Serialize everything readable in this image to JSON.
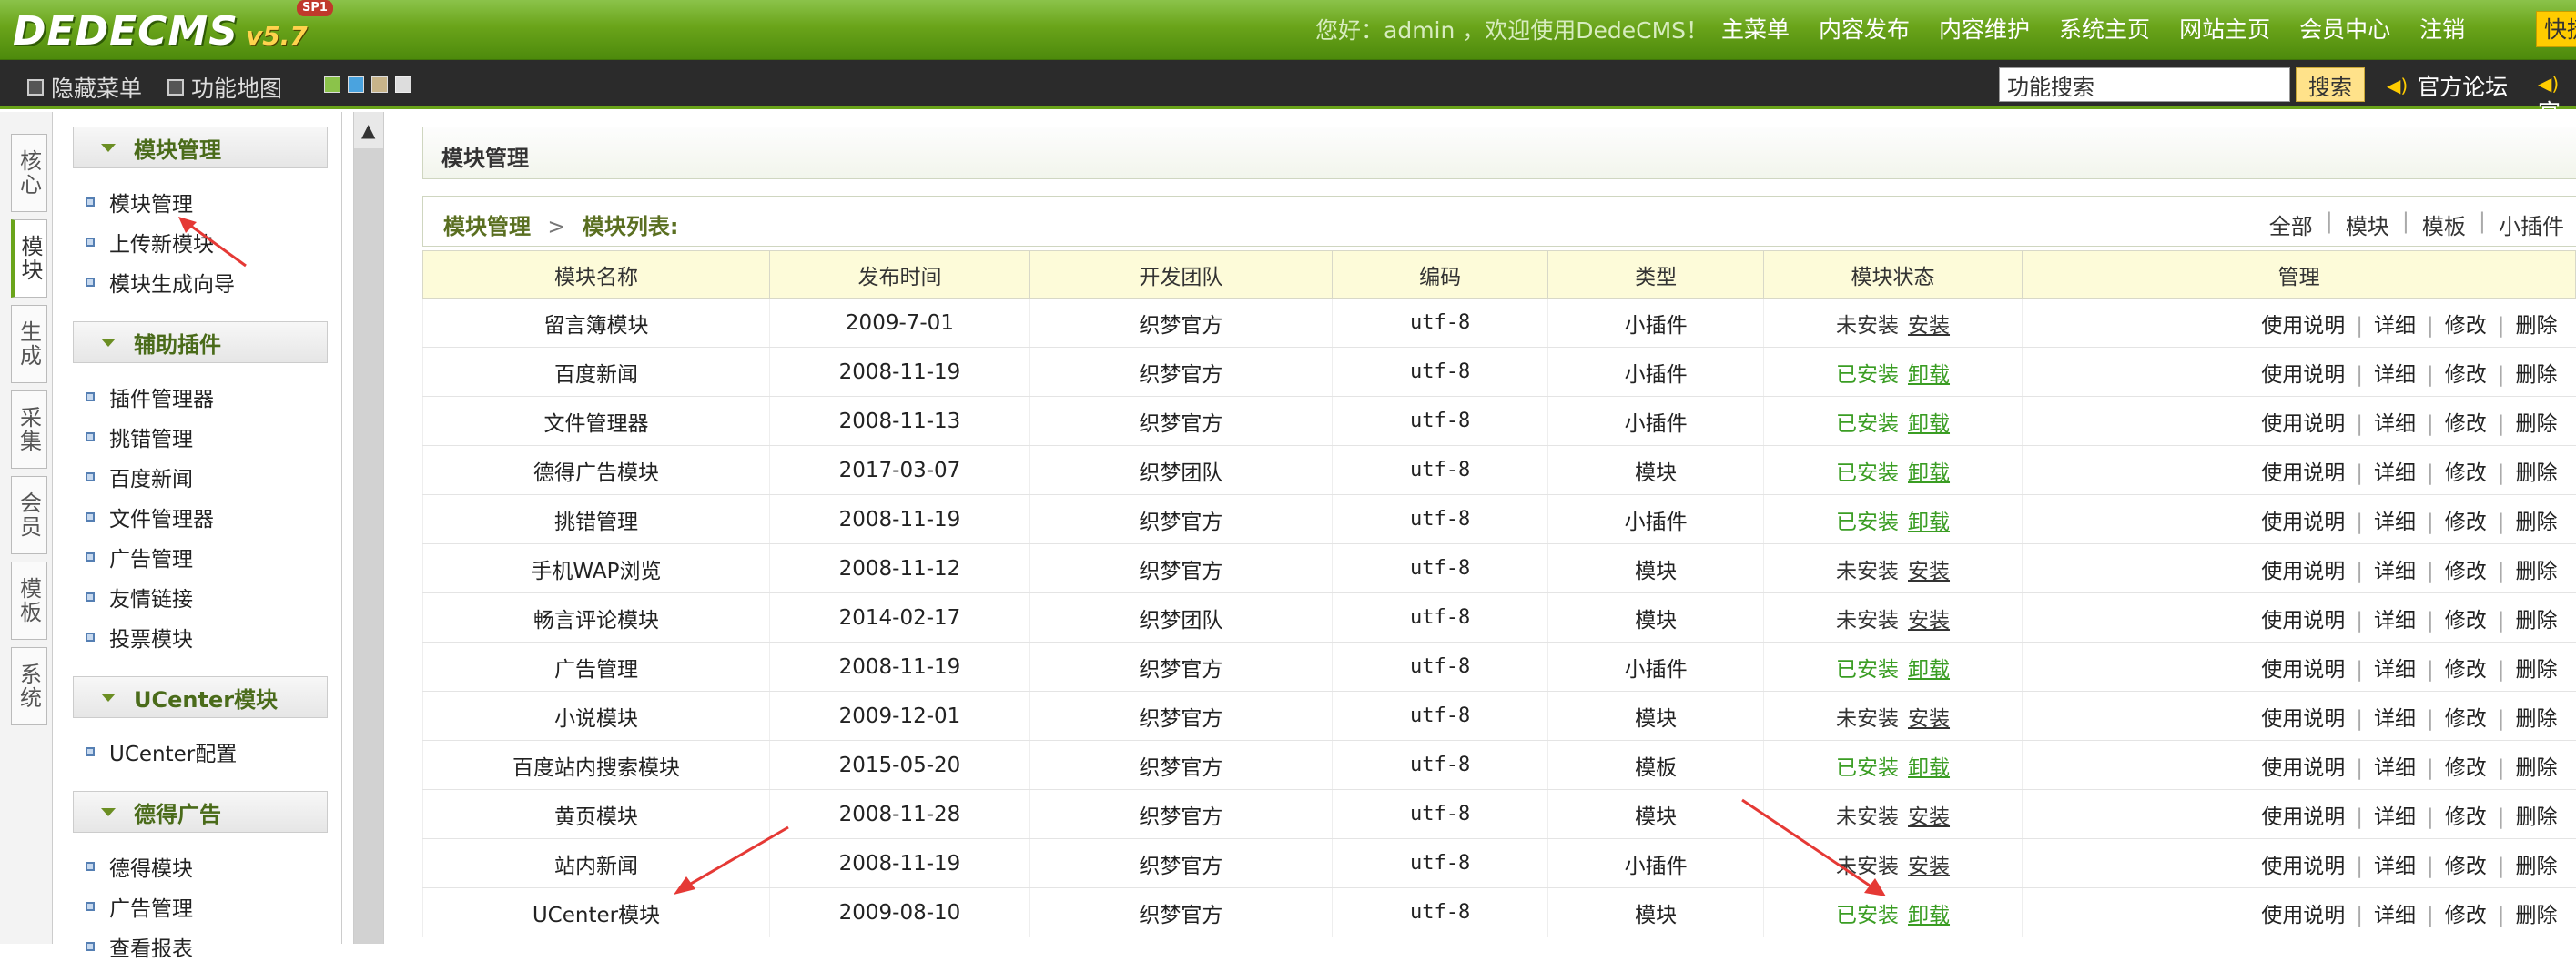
{
  "header": {
    "logo_text": "DEDECMS",
    "logo_version": "v5.7",
    "logo_badge": "SP1",
    "welcome": "您好：admin ，欢迎使用DedeCMS！",
    "nav": [
      "主菜单",
      "内容发布",
      "内容维护",
      "系统主页",
      "网站主页",
      "会员中心",
      "注销"
    ],
    "quick": "快捷"
  },
  "subbar": {
    "hide_menu": "隐藏菜单",
    "func_map": "功能地图",
    "search_value": "功能搜索",
    "search_button": "搜索",
    "forum": "官方论坛",
    "forum_more": "官"
  },
  "vtabs": [
    "核心",
    "模块",
    "生成",
    "采集",
    "会员",
    "模板",
    "系统"
  ],
  "leftmenu": {
    "groups": [
      {
        "title": "模块管理",
        "items": [
          "模块管理",
          "上传新模块",
          "模块生成向导"
        ]
      },
      {
        "title": "辅助插件",
        "items": [
          "插件管理器",
          "挑错管理",
          "百度新闻",
          "文件管理器",
          "广告管理",
          "友情链接",
          "投票模块"
        ]
      },
      {
        "title": "UCenter模块",
        "items": [
          "UCenter配置"
        ]
      },
      {
        "title": "德得广告",
        "items": [
          "德得模块",
          "广告管理",
          "查看报表"
        ]
      }
    ]
  },
  "main": {
    "page_title": "模块管理",
    "breadcrumb": [
      "模块管理",
      "模块列表:"
    ],
    "breadcrumb_sep": ">",
    "filters": [
      "全部",
      "模块",
      "模板",
      "小插件"
    ],
    "columns": [
      "模块名称",
      "发布时间",
      "开发团队",
      "编码",
      "类型",
      "模块状态",
      "管理"
    ],
    "manage_actions": [
      "使用说明",
      "详细",
      "修改",
      "删除"
    ],
    "rows": [
      {
        "name": "留言簿模块",
        "date": "2009-7-01",
        "team": "织梦官方",
        "code": "utf-8",
        "type": "小插件",
        "status": "未安装",
        "action": "安装"
      },
      {
        "name": "百度新闻",
        "date": "2008-11-19",
        "team": "织梦官方",
        "code": "utf-8",
        "type": "小插件",
        "status": "已安装",
        "action": "卸载"
      },
      {
        "name": "文件管理器",
        "date": "2008-11-13",
        "team": "织梦官方",
        "code": "utf-8",
        "type": "小插件",
        "status": "已安装",
        "action": "卸载"
      },
      {
        "name": "德得广告模块",
        "date": "2017-03-07",
        "team": "织梦团队",
        "code": "utf-8",
        "type": "模块",
        "status": "已安装",
        "action": "卸载"
      },
      {
        "name": "挑错管理",
        "date": "2008-11-19",
        "team": "织梦官方",
        "code": "utf-8",
        "type": "小插件",
        "status": "已安装",
        "action": "卸载"
      },
      {
        "name": "手机WAP浏览",
        "date": "2008-11-12",
        "team": "织梦官方",
        "code": "utf-8",
        "type": "模块",
        "status": "未安装",
        "action": "安装"
      },
      {
        "name": "畅言评论模块",
        "date": "2014-02-17",
        "team": "织梦团队",
        "code": "utf-8",
        "type": "模块",
        "status": "未安装",
        "action": "安装"
      },
      {
        "name": "广告管理",
        "date": "2008-11-19",
        "team": "织梦官方",
        "code": "utf-8",
        "type": "小插件",
        "status": "已安装",
        "action": "卸载"
      },
      {
        "name": "小说模块",
        "date": "2009-12-01",
        "team": "织梦官方",
        "code": "utf-8",
        "type": "模块",
        "status": "未安装",
        "action": "安装"
      },
      {
        "name": "百度站内搜索模块",
        "date": "2015-05-20",
        "team": "织梦官方",
        "code": "utf-8",
        "type": "模板",
        "status": "已安装",
        "action": "卸载"
      },
      {
        "name": "黄页模块",
        "date": "2008-11-28",
        "team": "织梦官方",
        "code": "utf-8",
        "type": "模块",
        "status": "未安装",
        "action": "安装"
      },
      {
        "name": "站内新闻",
        "date": "2008-11-19",
        "team": "织梦官方",
        "code": "utf-8",
        "type": "小插件",
        "status": "未安装",
        "action": "安装"
      },
      {
        "name": "UCenter模块",
        "date": "2009-08-10",
        "team": "织梦官方",
        "code": "utf-8",
        "type": "模块",
        "status": "已安装",
        "action": "卸载"
      }
    ]
  },
  "colors": {
    "installed": "#3a9d23",
    "topbar": "#6aa41a",
    "header_row": "#fdfbd9",
    "annotation_arrow": "#e53935"
  }
}
